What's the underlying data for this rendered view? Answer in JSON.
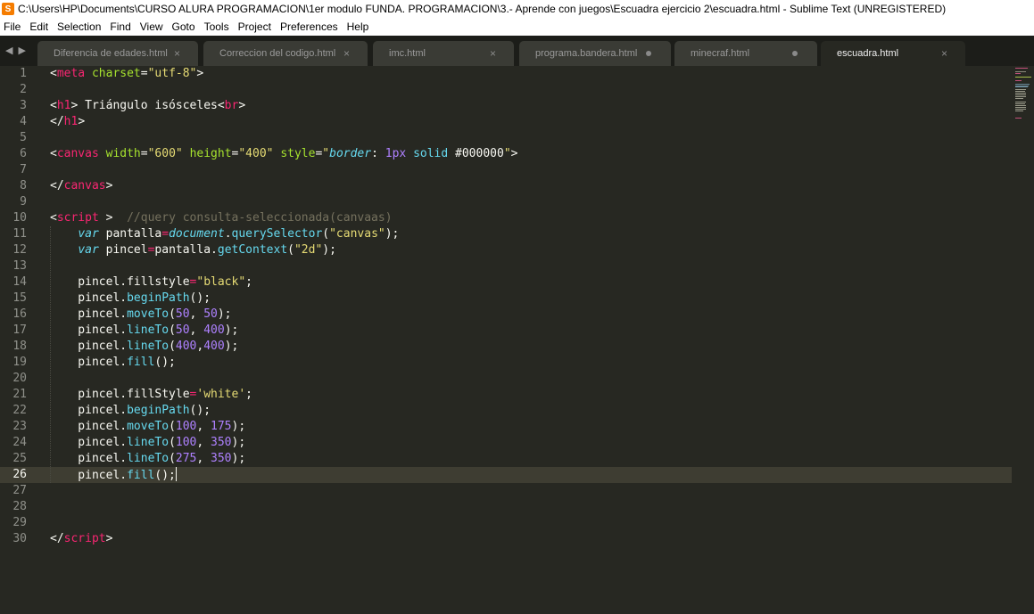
{
  "window": {
    "title": "C:\\Users\\HP\\Documents\\CURSO ALURA PROGRAMACION\\1er modulo FUNDA. PROGRAMACION\\3.- Aprende con juegos\\Escuadra ejercicio 2\\escuadra.html - Sublime Text (UNREGISTERED)"
  },
  "menu": {
    "file": "File",
    "edit": "Edit",
    "selection": "Selection",
    "find": "Find",
    "view": "View",
    "goto": "Goto",
    "tools": "Tools",
    "project": "Project",
    "preferences": "Preferences",
    "help": "Help"
  },
  "tabs": [
    {
      "label": "Diferencia de edades.html",
      "state": "close"
    },
    {
      "label": "Correccion del codigo.html",
      "state": "close"
    },
    {
      "label": "imc.html",
      "state": "close"
    },
    {
      "label": "programa.bandera.html",
      "state": "modified"
    },
    {
      "label": "minecraf.html",
      "state": "modified"
    },
    {
      "label": "escuadra.html",
      "state": "close",
      "active": true
    }
  ],
  "icons": {
    "close": "×",
    "nav_left": "◀",
    "nav_right": "▶",
    "app": "S"
  },
  "colors": {
    "background": "#272822",
    "tag": "#f92672",
    "attribute": "#a6e22e",
    "string": "#e6db74",
    "comment": "#75715e",
    "function": "#66d9ef",
    "number": "#ae81ff"
  },
  "editor": {
    "current_line": 26,
    "line_numbers": [
      "1",
      "2",
      "3",
      "4",
      "5",
      "6",
      "7",
      "8",
      "9",
      "10",
      "11",
      "12",
      "13",
      "14",
      "15",
      "16",
      "17",
      "18",
      "19",
      "20",
      "21",
      "22",
      "23",
      "24",
      "25",
      "26",
      "27",
      "28",
      "29",
      "30"
    ],
    "lines": {
      "l1": {
        "a": "<",
        "b": "meta",
        "c": " ",
        "d": "charset",
        "e": "=",
        "f": "\"utf-8\"",
        "g": ">"
      },
      "l3": {
        "a": "<",
        "b": "h1",
        "c": "> Triángulo isósceles<",
        "d": "br",
        "e": ">"
      },
      "l4": {
        "a": "</",
        "b": "h1",
        "c": ">"
      },
      "l6": {
        "a": "<",
        "b": "canvas",
        "c": " ",
        "d": "width",
        "e": "=",
        "f": "\"600\"",
        "g": " ",
        "h": "height",
        "i": "=",
        "j": "\"400\"",
        "k": " ",
        "l": "style",
        "m": "=",
        "n": "\"",
        "o": "border",
        "p": ": ",
        "q": "1px",
        "r": " ",
        "s": "solid",
        "t": " #000000",
        "u": "\"",
        ">": ">"
      },
      "l8": {
        "a": "</",
        "b": "canvas",
        "c": ">"
      },
      "l10": {
        "a": "<",
        "b": "script",
        "c": " >  ",
        "d": "//query consulta-seleccionada(canvaas)"
      },
      "l11": {
        "a": "    ",
        "b": "var",
        "c": " pantalla",
        "d": "=",
        "e": "document",
        "f": ".",
        "g": "querySelector",
        "h": "(",
        "i": "\"canvas\"",
        "j": ");"
      },
      "l12": {
        "a": "    ",
        "b": "var",
        "c": " pincel",
        "d": "=",
        "e": "pantalla.",
        "f": "getContext",
        "g": "(",
        "h": "\"2d\"",
        "i": ");"
      },
      "l14": {
        "a": "    pincel.fillstyle",
        "b": "=",
        "c": "\"black\"",
        "d": ";"
      },
      "l15": {
        "a": "    pincel.",
        "b": "beginPath",
        "c": "();"
      },
      "l16": {
        "a": "    pincel.",
        "b": "moveTo",
        "c": "(",
        "d": "50",
        "e": ", ",
        "f": "50",
        "g": ");"
      },
      "l17": {
        "a": "    pincel.",
        "b": "lineTo",
        "c": "(",
        "d": "50",
        "e": ", ",
        "f": "400",
        "g": ");"
      },
      "l18": {
        "a": "    pincel.",
        "b": "lineTo",
        "c": "(",
        "d": "400",
        "e": ",",
        "f": "400",
        "g": ");"
      },
      "l19": {
        "a": "    pincel.",
        "b": "fill",
        "c": "();"
      },
      "l21": {
        "a": "    pincel.fillStyle",
        "b": "=",
        "c": "'white'",
        "d": ";"
      },
      "l22": {
        "a": "    pincel.",
        "b": "beginPath",
        "c": "();"
      },
      "l23": {
        "a": "    pincel.",
        "b": "moveTo",
        "c": "(",
        "d": "100",
        "e": ", ",
        "f": "175",
        "g": ");"
      },
      "l24": {
        "a": "    pincel.",
        "b": "lineTo",
        "c": "(",
        "d": "100",
        "e": ", ",
        "f": "350",
        "g": ");"
      },
      "l25": {
        "a": "    pincel.",
        "b": "lineTo",
        "c": "(",
        "d": "275",
        "e": ", ",
        "f": "350",
        "g": ");"
      },
      "l26": {
        "a": "    pincel.",
        "b": "fill",
        "c": "();"
      },
      "l30": {
        "a": "</",
        "b": "script",
        "c": ">"
      }
    }
  }
}
